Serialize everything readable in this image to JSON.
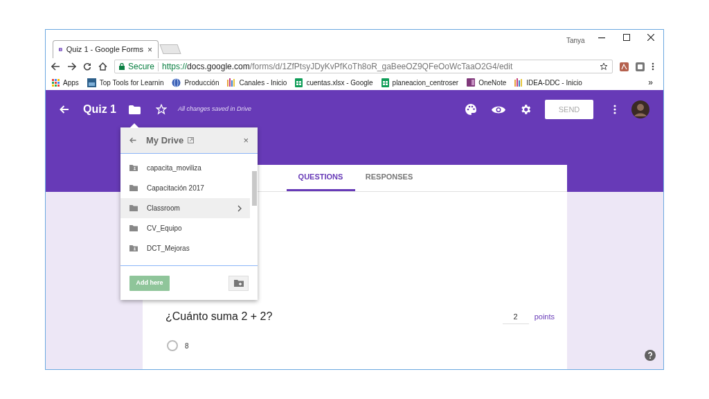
{
  "browser": {
    "tab_title": "Quiz 1 - Google Forms",
    "tab_close": "×",
    "user": "Tanya",
    "secure_label": "Secure",
    "url_scheme": "https://",
    "url_host": "docs.google.com",
    "url_path": "/forms/d/1ZfPtsyJDyKvPfKoTh8oR_gaBeeOZ9QFeOoWcTaaO2G4/edit",
    "bookmarks": [
      {
        "kind": "apps",
        "label": "Apps"
      },
      {
        "kind": "image",
        "label": "Top Tools for Learnin"
      },
      {
        "kind": "globe",
        "label": "Producción"
      },
      {
        "kind": "bars",
        "label": "Canales - Inicio"
      },
      {
        "kind": "sheet",
        "label": "cuentas.xlsx - Google"
      },
      {
        "kind": "sheet",
        "label": "planeacion_centroser"
      },
      {
        "kind": "onenote",
        "label": "OneNote"
      },
      {
        "kind": "bars",
        "label": "IDEA-DDC - Inicio"
      }
    ],
    "more_bookmarks": "»"
  },
  "header": {
    "title": "Quiz 1",
    "save_status": "All changes saved in Drive",
    "send_button": "SEND"
  },
  "tabs": [
    {
      "label": "QUESTIONS",
      "selected": true
    },
    {
      "label": "RESPONSES",
      "selected": false
    }
  ],
  "question": {
    "title": "¿Cuánto suma 2 + 2?",
    "points_value": "2",
    "points_label": "points",
    "options": [
      {
        "label": "8",
        "selected": false
      }
    ]
  },
  "drive_popup": {
    "title": "My Drive",
    "close": "×",
    "folders": [
      {
        "name": "capacita_moviliza",
        "kind": "shared",
        "selected": false
      },
      {
        "name": "Capacitación 2017",
        "kind": "folder",
        "selected": false
      },
      {
        "name": "Classroom",
        "kind": "folder",
        "selected": true
      },
      {
        "name": "CV_Equipo",
        "kind": "folder",
        "selected": false
      },
      {
        "name": "DCT_Mejoras",
        "kind": "shared",
        "selected": false
      }
    ],
    "add_button": "Add here"
  }
}
